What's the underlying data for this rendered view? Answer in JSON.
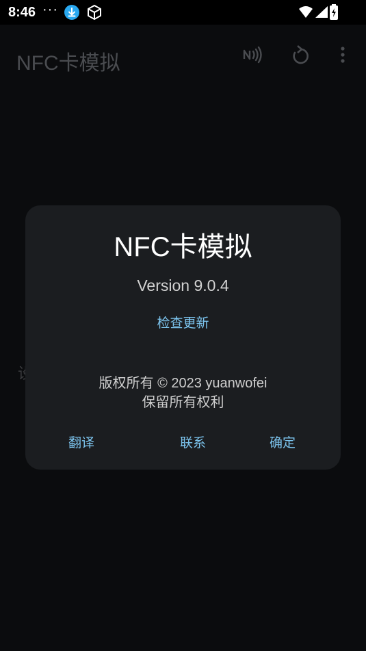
{
  "status_bar": {
    "time": "8:46",
    "dots": "···"
  },
  "app_bar": {
    "title": "NFC卡模拟"
  },
  "background": {
    "partial_text": "设"
  },
  "dialog": {
    "title": "NFC卡模拟",
    "version": "Version 9.0.4",
    "check_update": "检查更新",
    "copyright_line1": "版权所有 © 2023 yuanwofei",
    "copyright_line2": "保留所有权利",
    "buttons": {
      "translate": "翻译",
      "contact": "联系",
      "ok": "确定"
    }
  },
  "colors": {
    "dialog_bg": "#1b1d20",
    "accent": "#7cc4ee",
    "page_bg": "#0b0c0e"
  }
}
